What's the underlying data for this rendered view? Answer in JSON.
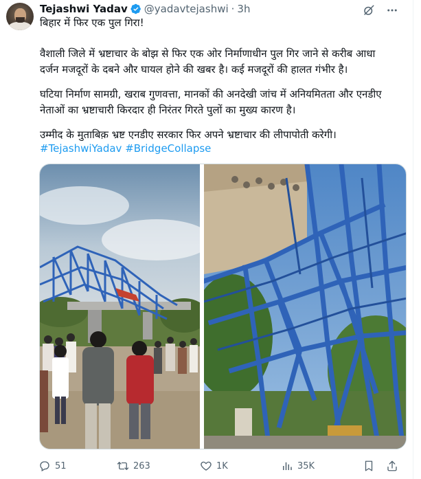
{
  "author": {
    "name": "Tejashwi Yadav",
    "handle": "@yadavtejashwi",
    "separator": "·",
    "time": "3h"
  },
  "post": {
    "headline": "बिहार में फिर एक पुल गिरा!",
    "paragraph1_line1": "वैशाली जिले में भ्रष्टाचार के बोझ से फिर एक ओर निर्माणाधीन पुल गिर जाने से करीब आधा",
    "paragraph1_line2": "दर्जन मजदूरों के दबने और घायल होने की खबर है। कई मजदूरों की हालत गंभीर है।",
    "paragraph2_line1": "घटिया निर्माण सामग्री, खराब गुणवत्ता, मानकों की अनदेखी जांच में अनियमितता और एनडीए",
    "paragraph2_line2": "नेताओं का भ्रष्टाचारी किरदार ही निरंतर गिरते पुलों का मुख्य कारण है।",
    "paragraph3": "उम्मीद के मुताबिक़ भ्रष्ट एनडीए सरकार फिर अपने भ्रष्टाचार की लीपापोती करेगी।",
    "hashtags": [
      "#TejashwiYadav",
      "#BridgeCollapse"
    ]
  },
  "stats": {
    "replies": "51",
    "reposts": "263",
    "likes": "1K",
    "views": "35K"
  },
  "icons": {
    "verified": "verified-badge-icon",
    "grok": "grok-icon",
    "more": "more-options-icon",
    "reply": "reply-icon",
    "repost": "repost-icon",
    "like": "heart-icon",
    "views": "views-chart-icon",
    "bookmark": "bookmark-icon",
    "share": "share-icon"
  },
  "colors": {
    "accent": "#1d9bf0",
    "muted": "#536471",
    "text": "#0f1419",
    "bridge_blue": "#2f63b8"
  }
}
